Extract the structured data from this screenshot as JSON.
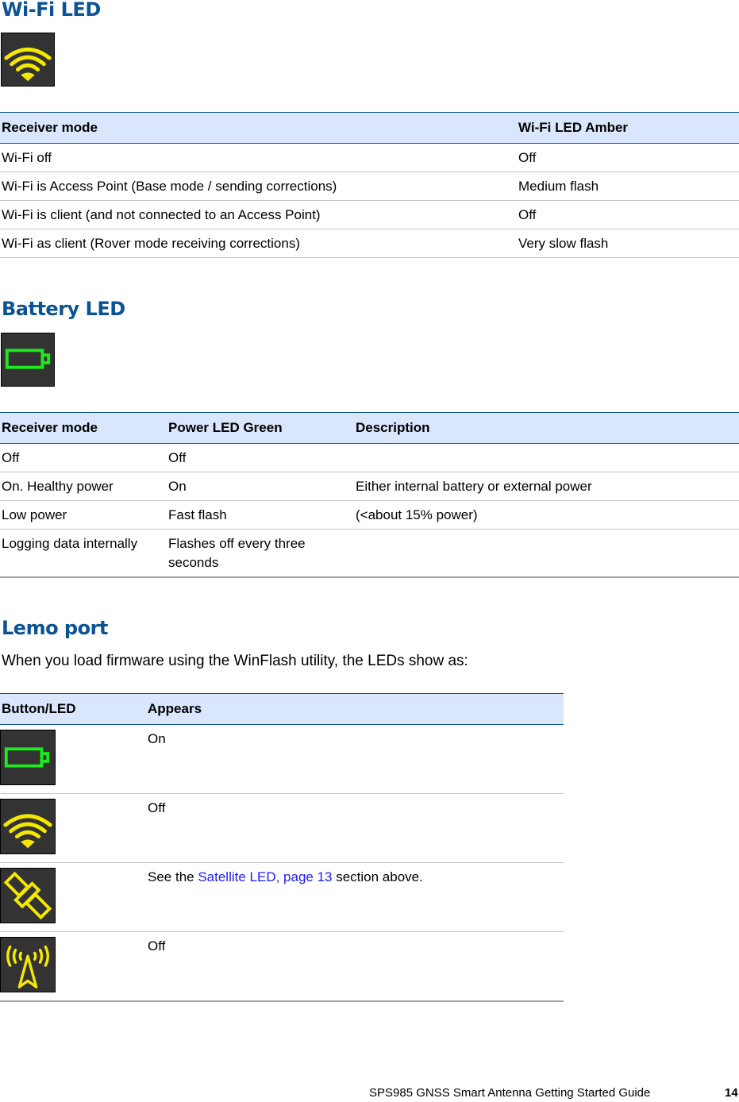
{
  "wifi_section": {
    "title": "Wi-Fi LED",
    "icon": "wifi-icon",
    "table": {
      "headers": [
        "Receiver mode",
        "Wi-Fi LED Amber"
      ],
      "rows": [
        [
          "Wi-Fi off",
          "Off"
        ],
        [
          "Wi-Fi is Access Point (Base mode / sending corrections)",
          "Medium flash"
        ],
        [
          "Wi-Fi is client (and not connected to an Access Point)",
          "Off"
        ],
        [
          "Wi-Fi as client (Rover mode receiving corrections)",
          "Very slow flash"
        ]
      ]
    }
  },
  "battery_section": {
    "title": "Battery LED",
    "icon": "battery-icon",
    "table": {
      "headers": [
        "Receiver mode",
        "Power LED Green",
        "Description"
      ],
      "rows": [
        [
          "Off",
          "Off",
          ""
        ],
        [
          "On. Healthy power",
          "On",
          "Either internal battery or external power"
        ],
        [
          "Low power",
          "Fast flash",
          "(<about 15% power)"
        ],
        [
          "Logging data internally",
          "Flashes off every three seconds",
          ""
        ]
      ]
    }
  },
  "lemo_section": {
    "title": "Lemo port",
    "intro": "When you load firmware using the WinFlash utility, the LEDs show as:",
    "table": {
      "headers": [
        "Button/LED",
        "Appears"
      ],
      "rows": [
        {
          "icon": "battery-icon",
          "appears": "On"
        },
        {
          "icon": "wifi-icon",
          "appears": "Off"
        },
        {
          "icon": "satellite-icon",
          "appears_prefix": "See the ",
          "link_text": "Satellite LED, page 13",
          "appears_suffix": " section above."
        },
        {
          "icon": "radio-tower-icon",
          "appears": "Off"
        }
      ]
    }
  },
  "colors": {
    "heading": "#0b5394",
    "table_header_bg": "#d9e6fb",
    "link": "#1a1aff",
    "wifi_led": "#f5e800",
    "battery_led": "#1ee81e",
    "icon_bg": "#333333"
  },
  "footer": {
    "guide_title": "SPS985 GNSS Smart Antenna Getting Started Guide",
    "page_number": "14"
  }
}
